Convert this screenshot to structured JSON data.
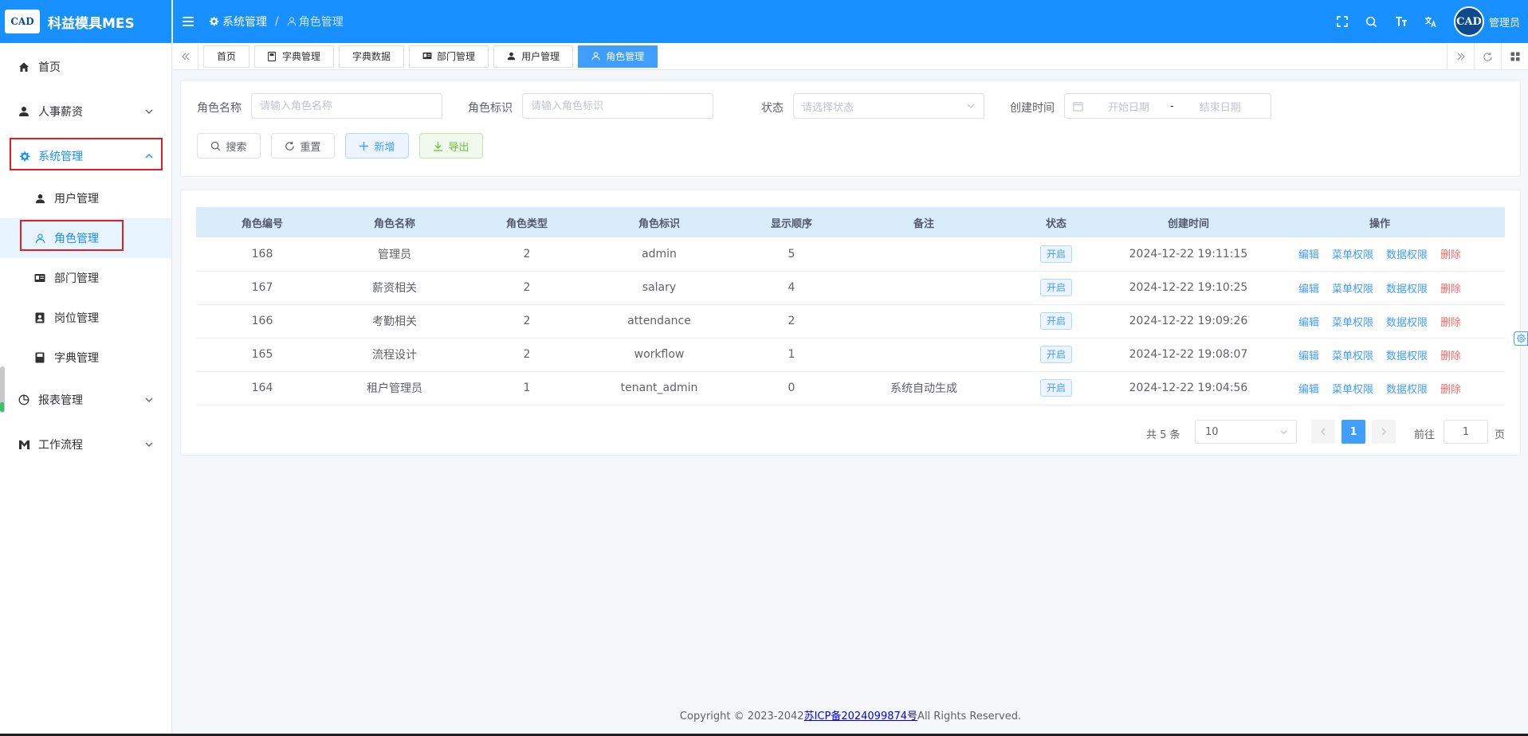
{
  "app": {
    "logo_text": "CAD",
    "title": "科益模具MES"
  },
  "sidebar": {
    "items": [
      {
        "label": "首页"
      },
      {
        "label": "人事薪资"
      },
      {
        "label": "系统管理"
      },
      {
        "label": "报表管理"
      },
      {
        "label": "工作流程"
      }
    ],
    "sub_items": [
      {
        "label": "用户管理"
      },
      {
        "label": "角色管理"
      },
      {
        "label": "部门管理"
      },
      {
        "label": "岗位管理"
      },
      {
        "label": "字典管理"
      }
    ]
  },
  "header": {
    "breadcrumb": [
      "系统管理",
      "角色管理"
    ],
    "separator": "/",
    "avatar_text": "CAD",
    "username": "管理员"
  },
  "tabs": [
    {
      "label": "首页"
    },
    {
      "label": "字典管理"
    },
    {
      "label": "字典数据"
    },
    {
      "label": "部门管理"
    },
    {
      "label": "用户管理"
    },
    {
      "label": "角色管理"
    }
  ],
  "search": {
    "role_name_label": "角色名称",
    "role_name_placeholder": "请输入角色名称",
    "role_key_label": "角色标识",
    "role_key_placeholder": "请输入角色标识",
    "status_label": "状态",
    "status_placeholder": "请选择状态",
    "created_label": "创建时间",
    "start_placeholder": "开始日期",
    "range_sep": "-",
    "end_placeholder": "结束日期",
    "btn_search": "搜索",
    "btn_reset": "重置",
    "btn_add": "新增",
    "btn_export": "导出"
  },
  "table": {
    "columns": [
      "角色编号",
      "角色名称",
      "角色类型",
      "角色标识",
      "显示顺序",
      "备注",
      "状态",
      "创建时间",
      "操作"
    ],
    "rows": [
      {
        "id": "168",
        "name": "管理员",
        "type": "2",
        "key": "admin",
        "order": "5",
        "remark": "",
        "status": "开启",
        "created": "2024-12-22 19:11:15"
      },
      {
        "id": "167",
        "name": "薪资相关",
        "type": "2",
        "key": "salary",
        "order": "4",
        "remark": "",
        "status": "开启",
        "created": "2024-12-22 19:10:25"
      },
      {
        "id": "166",
        "name": "考勤相关",
        "type": "2",
        "key": "attendance",
        "order": "2",
        "remark": "",
        "status": "开启",
        "created": "2024-12-22 19:09:26"
      },
      {
        "id": "165",
        "name": "流程设计",
        "type": "2",
        "key": "workflow",
        "order": "1",
        "remark": "",
        "status": "开启",
        "created": "2024-12-22 19:08:07"
      },
      {
        "id": "164",
        "name": "租户管理员",
        "type": "1",
        "key": "tenant_admin",
        "order": "0",
        "remark": "系统自动生成",
        "status": "开启",
        "created": "2024-12-22 19:04:56"
      }
    ],
    "actions": {
      "edit": "编辑",
      "menu_perm": "菜单权限",
      "data_perm": "数据权限",
      "delete": "删除"
    }
  },
  "pagination": {
    "total": "共 5 条",
    "page_size": "10",
    "current_page": "1",
    "goto_label": "前往",
    "goto_value": "1",
    "page_unit": "页"
  },
  "footer": {
    "prefix": "Copyright © 2023-2042",
    "icp": "苏ICP备2024099874号",
    "suffix": "All Rights Reserved."
  },
  "colors": {
    "primary": "#1890ff",
    "link": "#409eff",
    "danger": "#f56c6c",
    "success": "#67c23a",
    "highlight": "#e02020"
  }
}
